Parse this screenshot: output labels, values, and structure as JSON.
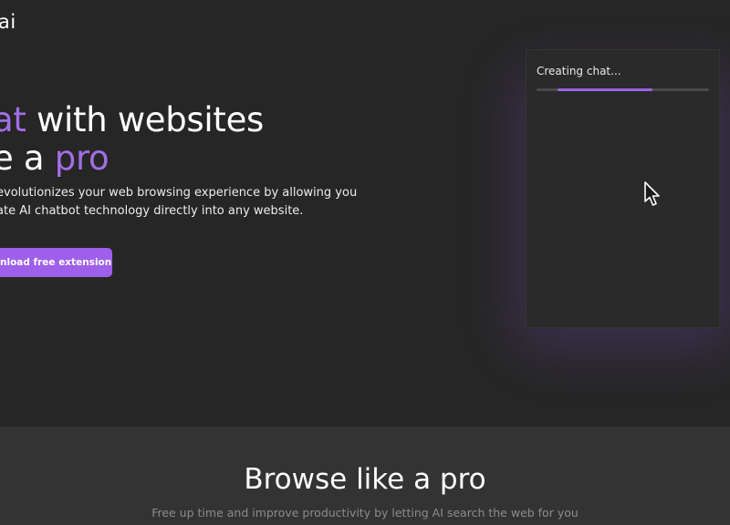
{
  "header": {
    "logo_text": "ai"
  },
  "hero": {
    "headline_line1_accent": "at",
    "headline_line1_rest": " with websites",
    "headline_line2_start": "e a ",
    "headline_line2_accent": "pro",
    "description_line1": "evolutionizes your web browsing experience by allowing you",
    "description_line2": "ate AI chatbot technology directly into any website.",
    "cta_label": "nload free extension"
  },
  "chat_panel": {
    "status_text": "Creating chat...",
    "progress_start": 0.12,
    "progress_end": 0.67
  },
  "features": {
    "title": "Browse like a pro",
    "subtitle": "Free up time and improve productivity by letting AI search the web for you"
  },
  "colors": {
    "background": "#262626",
    "section_background": "#333334",
    "accent": "#a26ee6",
    "button": "#9e5fea",
    "panel": "#2a2a2b"
  },
  "icons": {
    "pointer": "mouse-pointer-icon"
  }
}
